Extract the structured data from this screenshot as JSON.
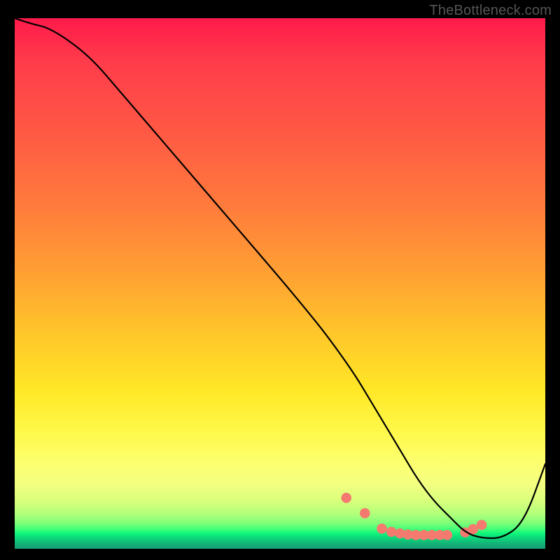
{
  "watermark": "TheBottleneck.com",
  "chart_data": {
    "type": "line",
    "title": "",
    "xlabel": "",
    "ylabel": "",
    "xlim": [
      0,
      100
    ],
    "ylim": [
      0,
      100
    ],
    "series": [
      {
        "name": "curve",
        "x": [
          0,
          3,
          7,
          14,
          20,
          26,
          32,
          38,
          44,
          50,
          55,
          59,
          64,
          67,
          70,
          73,
          76,
          79,
          82,
          85,
          88,
          92,
          96,
          100
        ],
        "y": [
          100,
          99,
          98,
          93,
          86,
          79,
          72,
          65,
          58,
          51,
          45,
          40,
          33,
          28,
          23,
          18,
          13,
          9,
          6,
          3,
          2,
          2,
          5,
          16
        ]
      }
    ],
    "markers": {
      "name": "dots",
      "x": [
        62.5,
        66.0,
        69.2,
        71.0,
        72.6,
        74.1,
        75.6,
        77.1,
        78.6,
        80.1,
        81.5,
        84.9,
        86.4,
        88.0
      ],
      "y": [
        9.6,
        6.7,
        3.8,
        3.2,
        2.9,
        2.7,
        2.6,
        2.6,
        2.6,
        2.6,
        2.6,
        3.1,
        3.7,
        4.5
      ],
      "color": "#f47a70",
      "radius": 7.3
    },
    "colors": {
      "line": "#000000",
      "background_top": "#ff1a4b",
      "background_bottom": "#159d74"
    }
  }
}
